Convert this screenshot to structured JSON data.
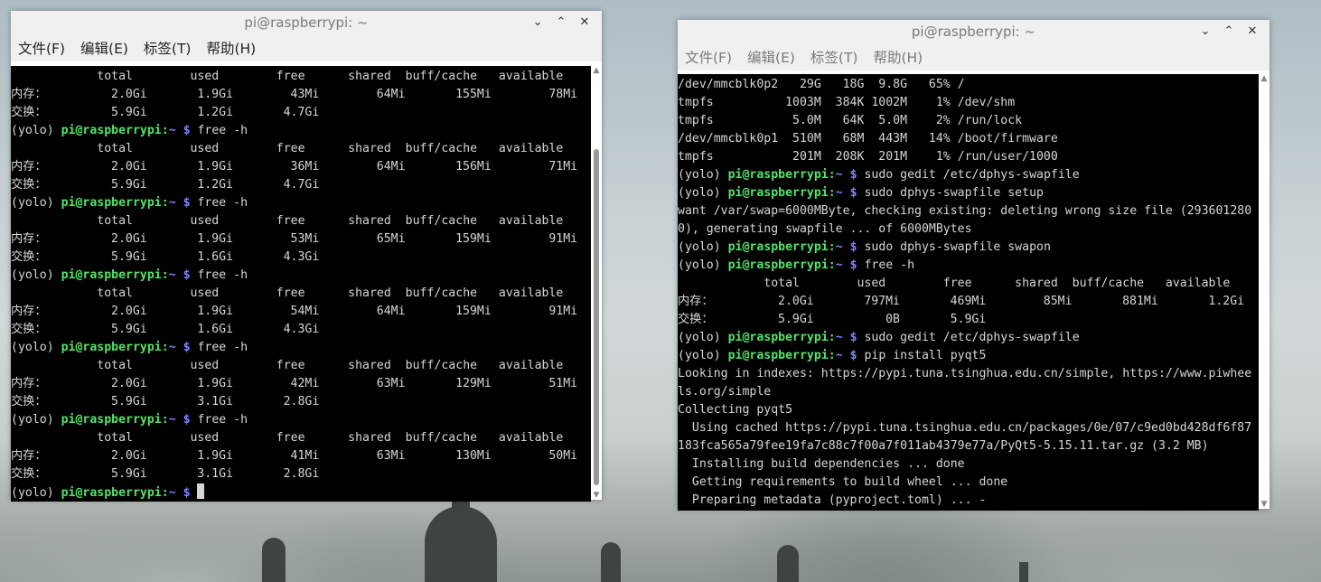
{
  "desktop": {},
  "left_window": {
    "title": "pi@raspberrypi: ~",
    "menu": [
      "文件(F)",
      "编辑(E)",
      "标签(T)",
      "帮助(H)"
    ],
    "lines": [
      [
        {
          "t": "            total        used        free      shared  buff/cache   available"
        }
      ],
      [
        {
          "t": "内存：         2.0Gi       1.9Gi        43Mi        64Mi       155Mi        78Mi"
        }
      ],
      [
        {
          "t": "交换：         5.9Gi       1.2Gi       4.7Gi"
        }
      ],
      [
        {
          "t": "(yolo) "
        },
        {
          "t": "pi@raspberrypi",
          "c": "g"
        },
        {
          "t": ":",
          "c": "g"
        },
        {
          "t": "~ $",
          "c": "b"
        },
        {
          "t": " free -h"
        }
      ],
      [
        {
          "t": "            total        used        free      shared  buff/cache   available"
        }
      ],
      [
        {
          "t": "内存：         2.0Gi       1.9Gi        36Mi        64Mi       156Mi        71Mi"
        }
      ],
      [
        {
          "t": "交换：         5.9Gi       1.2Gi       4.7Gi"
        }
      ],
      [
        {
          "t": "(yolo) "
        },
        {
          "t": "pi@raspberrypi",
          "c": "g"
        },
        {
          "t": ":",
          "c": "g"
        },
        {
          "t": "~ $",
          "c": "b"
        },
        {
          "t": " free -h"
        }
      ],
      [
        {
          "t": "            total        used        free      shared  buff/cache   available"
        }
      ],
      [
        {
          "t": "内存：         2.0Gi       1.9Gi        53Mi        65Mi       159Mi        91Mi"
        }
      ],
      [
        {
          "t": "交换：         5.9Gi       1.6Gi       4.3Gi"
        }
      ],
      [
        {
          "t": "(yolo) "
        },
        {
          "t": "pi@raspberrypi",
          "c": "g"
        },
        {
          "t": ":",
          "c": "g"
        },
        {
          "t": "~ $",
          "c": "b"
        },
        {
          "t": " free -h"
        }
      ],
      [
        {
          "t": "            total        used        free      shared  buff/cache   available"
        }
      ],
      [
        {
          "t": "内存：         2.0Gi       1.9Gi        54Mi        64Mi       159Mi        91Mi"
        }
      ],
      [
        {
          "t": "交换：         5.9Gi       1.6Gi       4.3Gi"
        }
      ],
      [
        {
          "t": "(yolo) "
        },
        {
          "t": "pi@raspberrypi",
          "c": "g"
        },
        {
          "t": ":",
          "c": "g"
        },
        {
          "t": "~ $",
          "c": "b"
        },
        {
          "t": " free -h"
        }
      ],
      [
        {
          "t": "            total        used        free      shared  buff/cache   available"
        }
      ],
      [
        {
          "t": "内存：         2.0Gi       1.9Gi        42Mi        63Mi       129Mi        51Mi"
        }
      ],
      [
        {
          "t": "交换：         5.9Gi       3.1Gi       2.8Gi"
        }
      ],
      [
        {
          "t": "(yolo) "
        },
        {
          "t": "pi@raspberrypi",
          "c": "g"
        },
        {
          "t": ":",
          "c": "g"
        },
        {
          "t": "~ $",
          "c": "b"
        },
        {
          "t": " free -h"
        }
      ],
      [
        {
          "t": "            total        used        free      shared  buff/cache   available"
        }
      ],
      [
        {
          "t": "内存：         2.0Gi       1.9Gi        41Mi        63Mi       130Mi        50Mi"
        }
      ],
      [
        {
          "t": "交换：         5.9Gi       3.1Gi       2.8Gi"
        }
      ],
      [
        {
          "t": "(yolo) "
        },
        {
          "t": "pi@raspberrypi",
          "c": "g"
        },
        {
          "t": ":",
          "c": "g"
        },
        {
          "t": "~ $",
          "c": "b"
        },
        {
          "t": " "
        },
        {
          "cursor": true
        }
      ]
    ]
  },
  "right_window": {
    "title": "pi@raspberrypi: ~",
    "menu": [
      "文件(F)",
      "编辑(E)",
      "标签(T)",
      "帮助(H)"
    ],
    "lines": [
      [
        {
          "t": "/dev/mmcblk0p2   29G   18G  9.8G   65% /"
        }
      ],
      [
        {
          "t": "tmpfs          1003M  384K 1002M    1% /dev/shm"
        }
      ],
      [
        {
          "t": "tmpfs           5.0M   64K  5.0M    2% /run/lock"
        }
      ],
      [
        {
          "t": "/dev/mmcblk0p1  510M   68M  443M   14% /boot/firmware"
        }
      ],
      [
        {
          "t": "tmpfs           201M  208K  201M    1% /run/user/1000"
        }
      ],
      [
        {
          "t": "(yolo) "
        },
        {
          "t": "pi@raspberrypi",
          "c": "g"
        },
        {
          "t": ":",
          "c": "g"
        },
        {
          "t": "~ $",
          "c": "b"
        },
        {
          "t": " sudo gedit /etc/dphys-swapfile"
        }
      ],
      [
        {
          "t": "(yolo) "
        },
        {
          "t": "pi@raspberrypi",
          "c": "g"
        },
        {
          "t": ":",
          "c": "g"
        },
        {
          "t": "~ $",
          "c": "b"
        },
        {
          "t": " sudo dphys-swapfile setup"
        }
      ],
      [
        {
          "t": "want /var/swap=6000MByte, checking existing: deleting wrong size file (293601280"
        }
      ],
      [
        {
          "t": "0), generating swapfile ... of 6000MBytes"
        }
      ],
      [
        {
          "t": "(yolo) "
        },
        {
          "t": "pi@raspberrypi",
          "c": "g"
        },
        {
          "t": ":",
          "c": "g"
        },
        {
          "t": "~ $",
          "c": "b"
        },
        {
          "t": " sudo dphys-swapfile swapon"
        }
      ],
      [
        {
          "t": "(yolo) "
        },
        {
          "t": "pi@raspberrypi",
          "c": "g"
        },
        {
          "t": ":",
          "c": "g"
        },
        {
          "t": "~ $",
          "c": "b"
        },
        {
          "t": " free -h"
        }
      ],
      [
        {
          "t": "            total        used        free      shared  buff/cache   available"
        }
      ],
      [
        {
          "t": "内存：         2.0Gi       797Mi       469Mi        85Mi       881Mi       1.2Gi"
        }
      ],
      [
        {
          "t": "交换：         5.9Gi          0B       5.9Gi"
        }
      ],
      [
        {
          "t": "(yolo) "
        },
        {
          "t": "pi@raspberrypi",
          "c": "g"
        },
        {
          "t": ":",
          "c": "g"
        },
        {
          "t": "~ $",
          "c": "b"
        },
        {
          "t": " sudo gedit /etc/dphys-swapfile"
        }
      ],
      [
        {
          "t": "(yolo) "
        },
        {
          "t": "pi@raspberrypi",
          "c": "g"
        },
        {
          "t": ":",
          "c": "g"
        },
        {
          "t": "~ $",
          "c": "b"
        },
        {
          "t": " pip install pyqt5"
        }
      ],
      [
        {
          "t": "Looking in indexes: https://pypi.tuna.tsinghua.edu.cn/simple, https://www.piwhee"
        }
      ],
      [
        {
          "t": "ls.org/simple"
        }
      ],
      [
        {
          "t": "Collecting pyqt5"
        }
      ],
      [
        {
          "t": "  Using cached https://pypi.tuna.tsinghua.edu.cn/packages/0e/07/c9ed0bd428df6f87"
        }
      ],
      [
        {
          "t": "183fca565a79fee19fa7c88c7f00a7f011ab4379e77a/PyQt5-5.15.11.tar.gz (3.2 MB)"
        }
      ],
      [
        {
          "t": "  Installing build dependencies ... done"
        }
      ],
      [
        {
          "t": "  Getting requirements to build wheel ... done"
        }
      ],
      [
        {
          "t": "  Preparing metadata (pyproject.toml) ... -"
        }
      ]
    ]
  },
  "icons": {
    "minimize": "chevron-down-icon",
    "maximize": "chevron-up-icon",
    "close": "close-icon"
  },
  "colors": {
    "prompt_user": "#53e36a",
    "prompt_path": "#7f83ff",
    "terminal_bg": "#000000",
    "terminal_fg": "#d6d6d6"
  }
}
